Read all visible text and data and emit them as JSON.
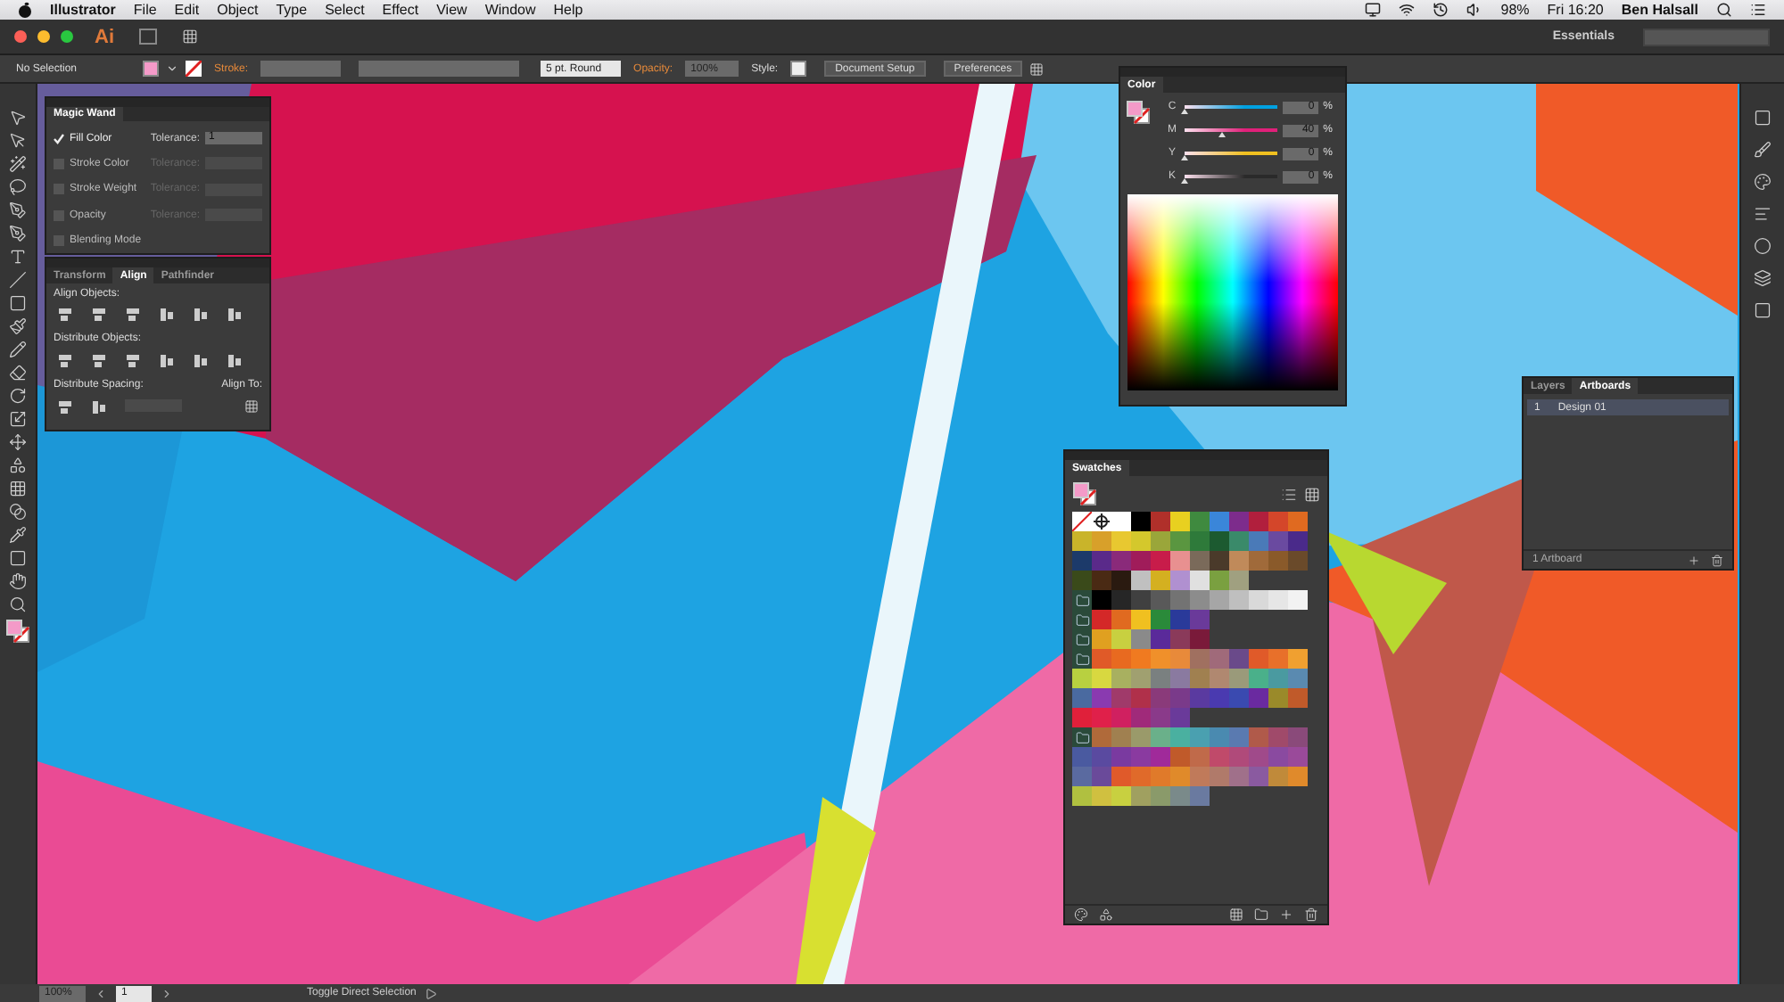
{
  "menubar": {
    "app": "Illustrator",
    "menus": [
      "File",
      "Edit",
      "Object",
      "Type",
      "Select",
      "Effect",
      "View",
      "Window",
      "Help"
    ],
    "battery": "98%",
    "clock": "Fri 16:20",
    "user": "Ben Halsall"
  },
  "app_bar": {
    "logo": "Ai",
    "workspace": "Essentials"
  },
  "control_bar": {
    "selection": "No Selection",
    "stroke_label": "Stroke:",
    "brush": "5 pt. Round",
    "opacity_label": "Opacity:",
    "opacity": "100%",
    "style_label": "Style:",
    "buttons": [
      "Document Setup",
      "Preferences"
    ]
  },
  "magic_wand": {
    "title": "Magic Wand",
    "options": [
      {
        "label": "Fill Color",
        "checked": true,
        "disabled": false,
        "tolerance_label": "Tolerance:",
        "tolerance": "1"
      },
      {
        "label": "Stroke Color",
        "checked": false,
        "disabled": true,
        "tolerance_label": "Tolerance:"
      },
      {
        "label": "Stroke Weight",
        "checked": false,
        "disabled": true,
        "tolerance_label": "Tolerance:"
      },
      {
        "label": "Opacity",
        "checked": false,
        "disabled": true,
        "tolerance_label": "Tolerance:"
      },
      {
        "label": "Blending Mode",
        "checked": false,
        "disabled": true
      }
    ]
  },
  "align": {
    "tabs": [
      {
        "label": "Transform",
        "selected": false
      },
      {
        "label": "Align",
        "selected": true
      },
      {
        "label": "Pathfinder",
        "selected": false
      }
    ],
    "align_objects": "Align Objects:",
    "distribute_objects": "Distribute Objects:",
    "distribute_spacing": "Distribute Spacing:",
    "align_to": "Align To:"
  },
  "color": {
    "title": "Color",
    "channels": [
      {
        "name": "C",
        "value": "0",
        "unit": "%",
        "level": 0,
        "color": "#00a0e0"
      },
      {
        "name": "M",
        "value": "40",
        "unit": "%",
        "level": 0.4,
        "color": "#e0207a"
      },
      {
        "name": "Y",
        "value": "0",
        "unit": "%",
        "level": 0,
        "color": "#f0c020"
      },
      {
        "name": "K",
        "value": "0",
        "unit": "%",
        "level": 0,
        "color": "#2a2a2a"
      }
    ]
  },
  "swatches": {
    "title": "Swatches",
    "rows": [
      {
        "kind": "special",
        "swatches": [
          {
            "color": "#ffffff"
          },
          {
            "color": "#000000"
          },
          {
            "color": "#b0302a"
          },
          {
            "color": "#e8d020"
          },
          {
            "color": "#3f8a3f"
          },
          {
            "color": "#3a86d9"
          },
          {
            "color": "#7d2c8c"
          },
          {
            "color": "#b11f3d"
          },
          {
            "color": "#d4462a"
          },
          {
            "color": "#e06a20"
          }
        ]
      },
      {
        "kind": "plain",
        "swatches": [
          {
            "color": "#c9b42a"
          },
          {
            "color": "#d8a02a"
          },
          {
            "color": "#e8c830"
          },
          {
            "color": "#d4c82c"
          },
          {
            "color": "#9aa63a"
          },
          {
            "color": "#5a9640"
          },
          {
            "color": "#2e7a3a"
          },
          {
            "color": "#1c5a30"
          },
          {
            "color": "#3a8a6a"
          },
          {
            "color": "#4a7ab8"
          },
          {
            "color": "#6a4aa0"
          },
          {
            "color": "#4a2a8a"
          }
        ]
      },
      {
        "kind": "plain",
        "swatches": [
          {
            "color": "#1c3a6a"
          },
          {
            "color": "#5a2a8a"
          },
          {
            "color": "#8a2a7a"
          },
          {
            "color": "#a01c5a"
          },
          {
            "color": "#c81c4a"
          },
          {
            "color": "#e89090"
          },
          {
            "color": "#7a6a5a"
          },
          {
            "color": "#4a3a2a"
          },
          {
            "color": "#c08a5a"
          },
          {
            "color": "#a06a3a"
          },
          {
            "color": "#8a5a2a"
          },
          {
            "color": "#6a4a2a"
          }
        ]
      },
      {
        "kind": "plain",
        "swatches": [
          {
            "color": "#3a4a1a"
          },
          {
            "color": "#4a2a14"
          },
          {
            "color": "#2a1a10"
          },
          {
            "color": "#c0c0c0"
          },
          {
            "color": "#d4b020"
          },
          {
            "color": "#b090d0"
          },
          {
            "color": "#e0e0e0"
          },
          {
            "color": "#7aa040"
          },
          {
            "color": "#a0a080"
          }
        ]
      },
      {
        "kind": "folder",
        "swatches": [
          {
            "color": "#000000"
          },
          {
            "color": "#262626"
          },
          {
            "color": "#404040"
          },
          {
            "color": "#595959"
          },
          {
            "color": "#737373"
          },
          {
            "color": "#8c8c8c"
          },
          {
            "color": "#a6a6a6"
          },
          {
            "color": "#bfbfbf"
          },
          {
            "color": "#d9d9d9"
          },
          {
            "color": "#e6e6e6"
          },
          {
            "color": "#f2f2f2"
          }
        ]
      },
      {
        "kind": "folder",
        "swatches": [
          {
            "color": "#d42828"
          },
          {
            "color": "#e06a20"
          },
          {
            "color": "#f0c020"
          },
          {
            "color": "#2a8a3a"
          },
          {
            "color": "#2a3a9a"
          },
          {
            "color": "#6a3a9a"
          }
        ]
      },
      {
        "kind": "folder",
        "swatches": [
          {
            "color": "#e0a020"
          },
          {
            "color": "#c8d040"
          },
          {
            "color": "#8a8a8a"
          },
          {
            "color": "#5a2a9a"
          },
          {
            "color": "#8a3a5a"
          },
          {
            "color": "#7a1a3a"
          }
        ]
      },
      {
        "kind": "folder",
        "swatches": [
          {
            "color": "#e05a28"
          },
          {
            "color": "#e86a20"
          },
          {
            "color": "#f07a20"
          },
          {
            "color": "#f0902a"
          },
          {
            "color": "#e88a3a"
          },
          {
            "color": "#a07060"
          },
          {
            "color": "#a06a7a"
          },
          {
            "color": "#6a4a8a"
          },
          {
            "color": "#e05a29"
          },
          {
            "color": "#e8702a"
          },
          {
            "color": "#f0a030"
          }
        ]
      },
      {
        "kind": "plain",
        "swatches": [
          {
            "color": "#b8d040"
          },
          {
            "color": "#d8d840"
          },
          {
            "color": "#a8b060"
          },
          {
            "color": "#a0a070"
          },
          {
            "color": "#7a8080"
          },
          {
            "color": "#8a7aa0"
          },
          {
            "color": "#a08050"
          },
          {
            "color": "#b08870"
          },
          {
            "color": "#9a9a7a"
          },
          {
            "color": "#4ab08a"
          },
          {
            "color": "#4a9aa0"
          },
          {
            "color": "#5a8ab0"
          }
        ]
      },
      {
        "kind": "plain",
        "swatches": [
          {
            "color": "#4a6aa0"
          },
          {
            "color": "#8a3ab0"
          },
          {
            "color": "#a03a6a"
          },
          {
            "color": "#b0304a"
          },
          {
            "color": "#8a3a7a"
          },
          {
            "color": "#7a3a8a"
          },
          {
            "color": "#5a3aa0"
          },
          {
            "color": "#4a3ab0"
          },
          {
            "color": "#3a4ab0"
          },
          {
            "color": "#6a2aa0"
          },
          {
            "color": "#9a8a2a"
          },
          {
            "color": "#c05a2a"
          }
        ]
      },
      {
        "kind": "plain",
        "swatches": [
          {
            "color": "#e0203a"
          },
          {
            "color": "#e0204a"
          },
          {
            "color": "#d02060"
          },
          {
            "color": "#a02a7a"
          },
          {
            "color": "#8a3a8a"
          },
          {
            "color": "#6a3a9a"
          }
        ]
      },
      {
        "kind": "folder",
        "swatches": [
          {
            "color": "#b06a3a"
          },
          {
            "color": "#a08050"
          },
          {
            "color": "#9a9a6a"
          },
          {
            "color": "#6ab08a"
          },
          {
            "color": "#4ab0a0"
          },
          {
            "color": "#4aa0b0"
          },
          {
            "color": "#4a8ab0"
          },
          {
            "color": "#5a7ab0"
          },
          {
            "color": "#b05a4a"
          },
          {
            "color": "#a04a6a"
          },
          {
            "color": "#8a4a7a"
          }
        ]
      },
      {
        "kind": "plain",
        "swatches": [
          {
            "color": "#4a5aa0"
          },
          {
            "color": "#5a4aa0"
          },
          {
            "color": "#7a3aa0"
          },
          {
            "color": "#8a3aa0"
          },
          {
            "color": "#a02a9a"
          },
          {
            "color": "#c05a2a"
          },
          {
            "color": "#c06a4a"
          },
          {
            "color": "#c04a6a"
          },
          {
            "color": "#b04a7a"
          },
          {
            "color": "#a04a8a"
          },
          {
            "color": "#8a4aa0"
          },
          {
            "color": "#9a4a9a"
          }
        ]
      },
      {
        "kind": "plain",
        "swatches": [
          {
            "color": "#5a6aa0"
          },
          {
            "color": "#6a4a9a"
          },
          {
            "color": "#e05a2a"
          },
          {
            "color": "#e06a2a"
          },
          {
            "color": "#e07a2a"
          },
          {
            "color": "#e08a2a"
          },
          {
            "color": "#c07a5a"
          },
          {
            "color": "#b07a6a"
          },
          {
            "color": "#a0708a"
          },
          {
            "color": "#8a5aa0"
          },
          {
            "color": "#c08a3a"
          },
          {
            "color": "#e08a2b"
          }
        ]
      },
      {
        "kind": "plain",
        "swatches": [
          {
            "color": "#b0c040"
          },
          {
            "color": "#d0c040"
          },
          {
            "color": "#c8d040"
          },
          {
            "color": "#a0a060"
          },
          {
            "color": "#8a9a6a"
          },
          {
            "color": "#7a8a8a"
          },
          {
            "color": "#6a7aa0"
          }
        ]
      }
    ]
  },
  "layers_panel": {
    "tabs": [
      {
        "label": "Layers",
        "selected": false
      },
      {
        "label": "Artboards",
        "selected": true
      }
    ],
    "artboards": [
      {
        "number": "1",
        "name": "Design 01",
        "selected": true
      }
    ],
    "count": "1 Artboard"
  },
  "status_bar": {
    "zoom": "100%",
    "artboard": "1",
    "message": "Toggle Direct Selection"
  }
}
